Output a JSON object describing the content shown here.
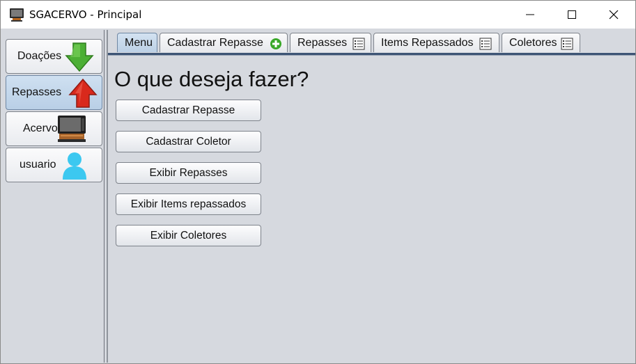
{
  "window": {
    "title": "SGACERVO - Principal",
    "controls": [
      "minimize",
      "maximize",
      "close"
    ]
  },
  "sidebar": {
    "items": [
      {
        "label": "Doações",
        "icon": "green-down-arrow-icon",
        "active": false
      },
      {
        "label": "Repasses",
        "icon": "red-up-arrow-icon",
        "active": true
      },
      {
        "label": "Acervo",
        "icon": "computer-icon",
        "active": false
      },
      {
        "label": "usuario",
        "icon": "user-icon",
        "active": false
      }
    ]
  },
  "tabs": [
    {
      "label": "Menu",
      "icon": "",
      "active": true
    },
    {
      "label": "Cadastrar Repasse",
      "icon": "green-plus-icon",
      "active": false
    },
    {
      "label": "Repasses",
      "icon": "list-icon",
      "active": false
    },
    {
      "label": "Items Repassados",
      "icon": "list-icon",
      "active": false
    },
    {
      "label": "Coletores",
      "icon": "list-icon",
      "active": false
    }
  ],
  "menu": {
    "heading": "O que deseja fazer?",
    "buttons": [
      {
        "label": "Cadastrar Repasse"
      },
      {
        "label": "Cadastrar Coletor"
      },
      {
        "label": "Exibir Repasses"
      },
      {
        "label": "Exibir Items repassados"
      },
      {
        "label": "Exibir Coletores"
      }
    ]
  },
  "colors": {
    "window_bg": "#d6d9df",
    "active_item": "#c4d7ec",
    "tab_underline": "#3d5475",
    "green_accent": "#4caf35",
    "red_accent": "#d9291c",
    "user_icon": "#3cc8f0"
  }
}
